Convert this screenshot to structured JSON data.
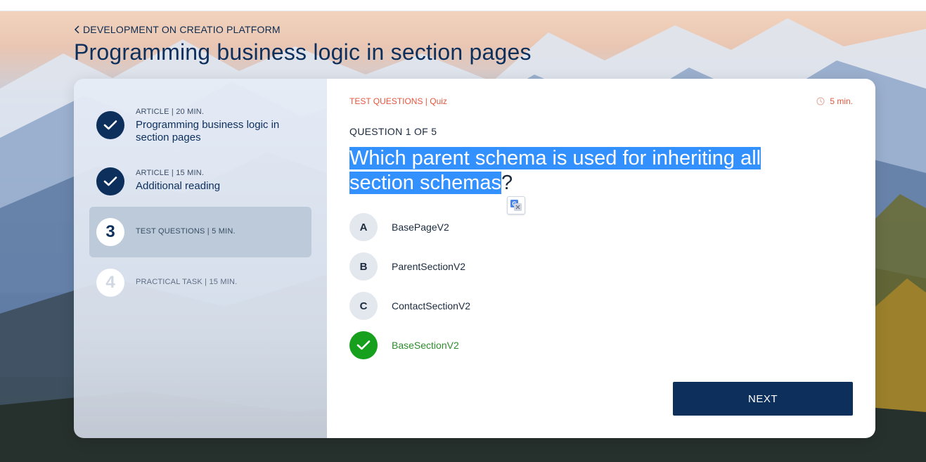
{
  "breadcrumb": {
    "back_label": "DEVELOPMENT ON CREATIO PLATFORM",
    "icon": "chevron-left-icon"
  },
  "page_title": "Programming business logic in section pages",
  "steps": [
    {
      "marker": "",
      "status": "done",
      "icon": "check-icon",
      "meta": "ARTICLE | 20 MIN.",
      "name": "Programming business logic in section pages"
    },
    {
      "marker": "",
      "status": "done",
      "icon": "check-icon",
      "meta": "ARTICLE | 15 MIN.",
      "name": "Additional reading"
    },
    {
      "marker": "3",
      "status": "current",
      "meta": "TEST QUESTIONS | 5 MIN.",
      "name": ""
    },
    {
      "marker": "4",
      "status": "todo",
      "meta": "PRACTICAL TASK | 15 MIN.",
      "name": ""
    }
  ],
  "quiz": {
    "crumb": "TEST QUESTIONS | Quiz",
    "timer": "5 min.",
    "timer_icon": "clock-icon",
    "question_number": "QUESTION 1 OF 5",
    "question_selected": "Which parent schema is used for inheriting all section schemas",
    "question_rest": "?",
    "translate_icon": "google-translate-icon",
    "options": [
      {
        "letter": "A",
        "label": "BasePageV2",
        "correct": false
      },
      {
        "letter": "B",
        "label": "ParentSectionV2",
        "correct": false
      },
      {
        "letter": "C",
        "label": "ContactSectionV2",
        "correct": false
      },
      {
        "letter": "",
        "label": "BaseSectionV2",
        "correct": true,
        "icon": "check-icon"
      }
    ],
    "next_label": "NEXT"
  },
  "colors": {
    "navy": "#0d2f5c",
    "accent_red": "#e3563c",
    "correct_green": "#16a01e",
    "selection_blue": "#3390ff"
  }
}
